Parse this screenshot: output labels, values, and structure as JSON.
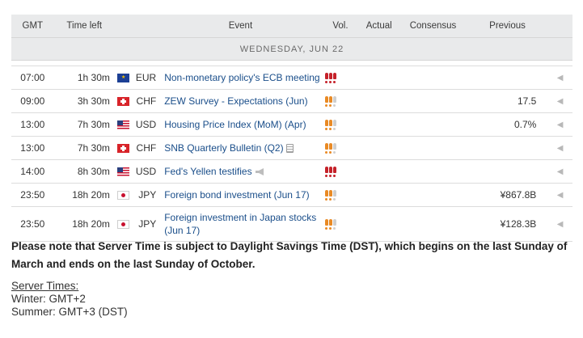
{
  "headers": {
    "gmt": "GMT",
    "time_left": "Time left",
    "event": "Event",
    "vol": "Vol.",
    "actual": "Actual",
    "consensus": "Consensus",
    "previous": "Previous"
  },
  "day_label": "WEDNESDAY, JUN 22",
  "events": [
    {
      "gmt": "07:00",
      "time_left": "1h 30m",
      "flag": "eu-flag-icon",
      "currency": "EUR",
      "event": "Non-monetary policy's ECB meeting",
      "volatility": "high",
      "actual": "",
      "consensus": "",
      "previous": ""
    },
    {
      "gmt": "09:00",
      "time_left": "3h 30m",
      "flag": "swiss-flag-icon",
      "currency": "CHF",
      "event": "ZEW Survey - Expectations (Jun)",
      "volatility": "medium",
      "actual": "",
      "consensus": "",
      "previous": "17.5"
    },
    {
      "gmt": "13:00",
      "time_left": "7h 30m",
      "flag": "us-flag-icon",
      "currency": "USD",
      "event": "Housing Price Index (MoM) (Apr)",
      "volatility": "medium",
      "actual": "",
      "consensus": "",
      "previous": "0.7%"
    },
    {
      "gmt": "13:00",
      "time_left": "7h 30m",
      "flag": "swiss-flag-icon",
      "currency": "CHF",
      "event": "SNB Quarterly Bulletin (Q2)",
      "volatility": "medium",
      "actual": "",
      "consensus": "",
      "previous": "",
      "extra_icon": "report-icon"
    },
    {
      "gmt": "14:00",
      "time_left": "8h 30m",
      "flag": "us-flag-icon",
      "currency": "USD",
      "event": "Fed's Yellen testifies",
      "volatility": "high",
      "actual": "",
      "consensus": "",
      "previous": "",
      "extra_icon": "speech-icon"
    },
    {
      "gmt": "23:50",
      "time_left": "18h 20m",
      "flag": "japan-flag-icon",
      "currency": "JPY",
      "event": "Foreign bond investment (Jun 17)",
      "volatility": "medium",
      "actual": "",
      "consensus": "",
      "previous": "¥867.8B"
    },
    {
      "gmt": "23:50",
      "time_left": "18h 20m",
      "flag": "japan-flag-icon",
      "currency": "JPY",
      "event": "Foreign investment in Japan stocks (Jun 17)",
      "volatility": "medium",
      "actual": "",
      "consensus": "",
      "previous": "¥128.3B"
    }
  ],
  "note": "Please note that Server Time is subject to Daylight Savings Time (DST), which begins on the last Sunday of March and ends on the last Sunday of October.",
  "server_times": {
    "heading": "Server Times:",
    "winter": "Winter: GMT+2",
    "summer": "Summer: GMT+3 (DST)"
  },
  "colors": {
    "event_link": "#1a4e8a",
    "high_vol": "#c5222a",
    "medium_vol": "#e98a25",
    "low_vol": "#cfcfcf",
    "header_bg": "#e9eaeb"
  }
}
